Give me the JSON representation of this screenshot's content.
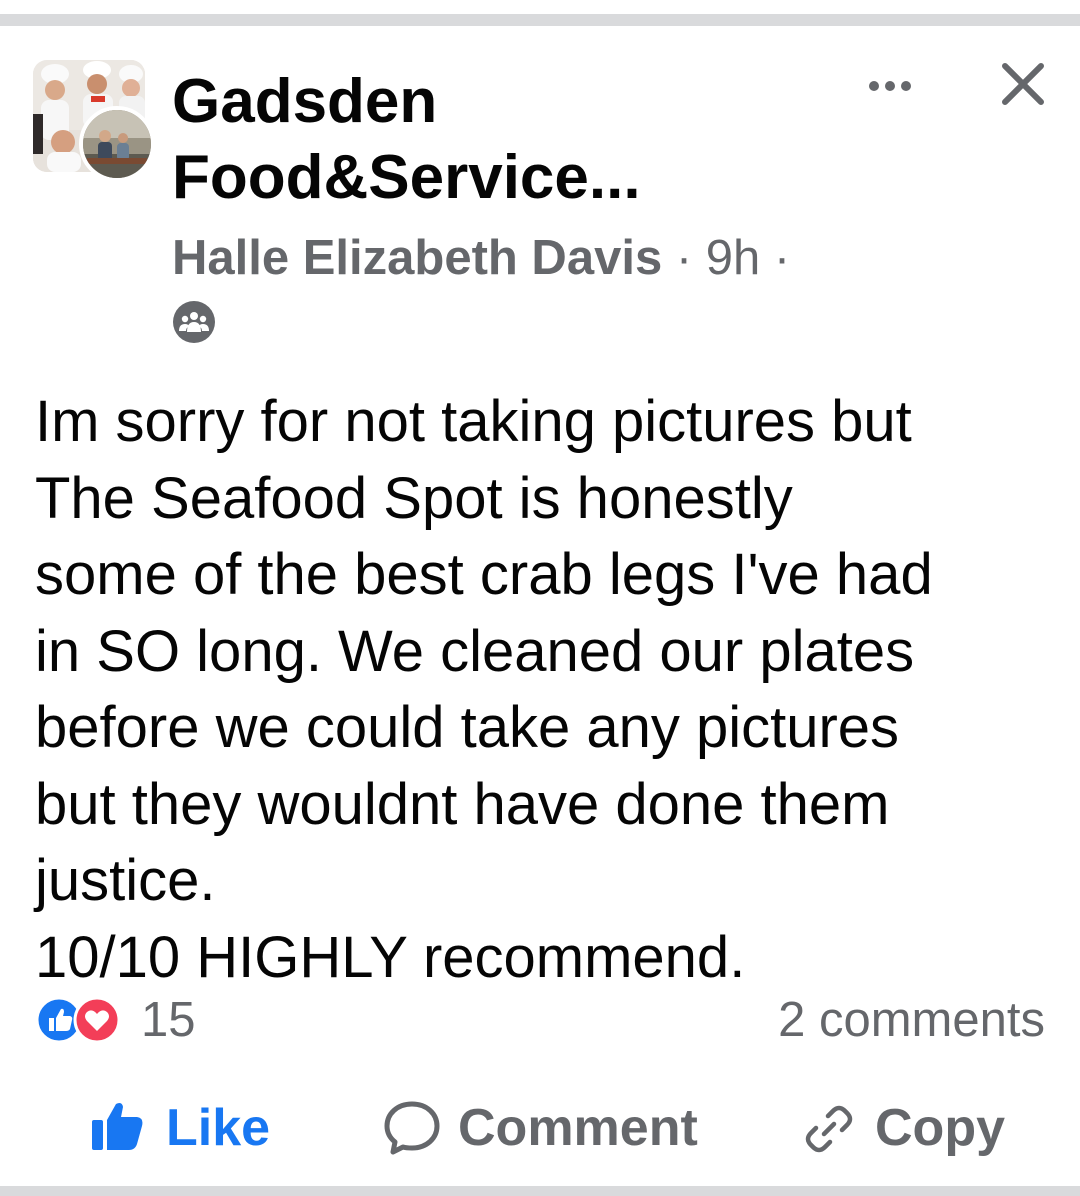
{
  "header": {
    "group_name": "Gadsden Food&Service...",
    "author": "Halle Elizabeth Davis",
    "separator": " · ",
    "time": "9h",
    "trailing_separator": " ·",
    "privacy_icon": "group-members-icon",
    "more_icon": "more-horizontal-icon",
    "close_icon": "close-icon"
  },
  "post": {
    "text": "Im sorry for not taking pictures but\nThe Seafood Spot is honestly\nsome of the best crab legs I've had\nin SO long. We cleaned our plates\nbefore we could take any pictures\nbut they wouldnt have done them\njustice.\n10/10 HIGHLY recommend."
  },
  "stats": {
    "reactions": [
      "like-reaction-icon",
      "love-reaction-icon"
    ],
    "reaction_count": "15",
    "comments": "2 comments"
  },
  "actions": {
    "like": "Like",
    "comment": "Comment",
    "copy": "Copy"
  },
  "colors": {
    "brand_blue": "#1877f2",
    "secondary_text": "#65676b",
    "love_red": "#f33e58",
    "divider": "#d9dadc"
  }
}
